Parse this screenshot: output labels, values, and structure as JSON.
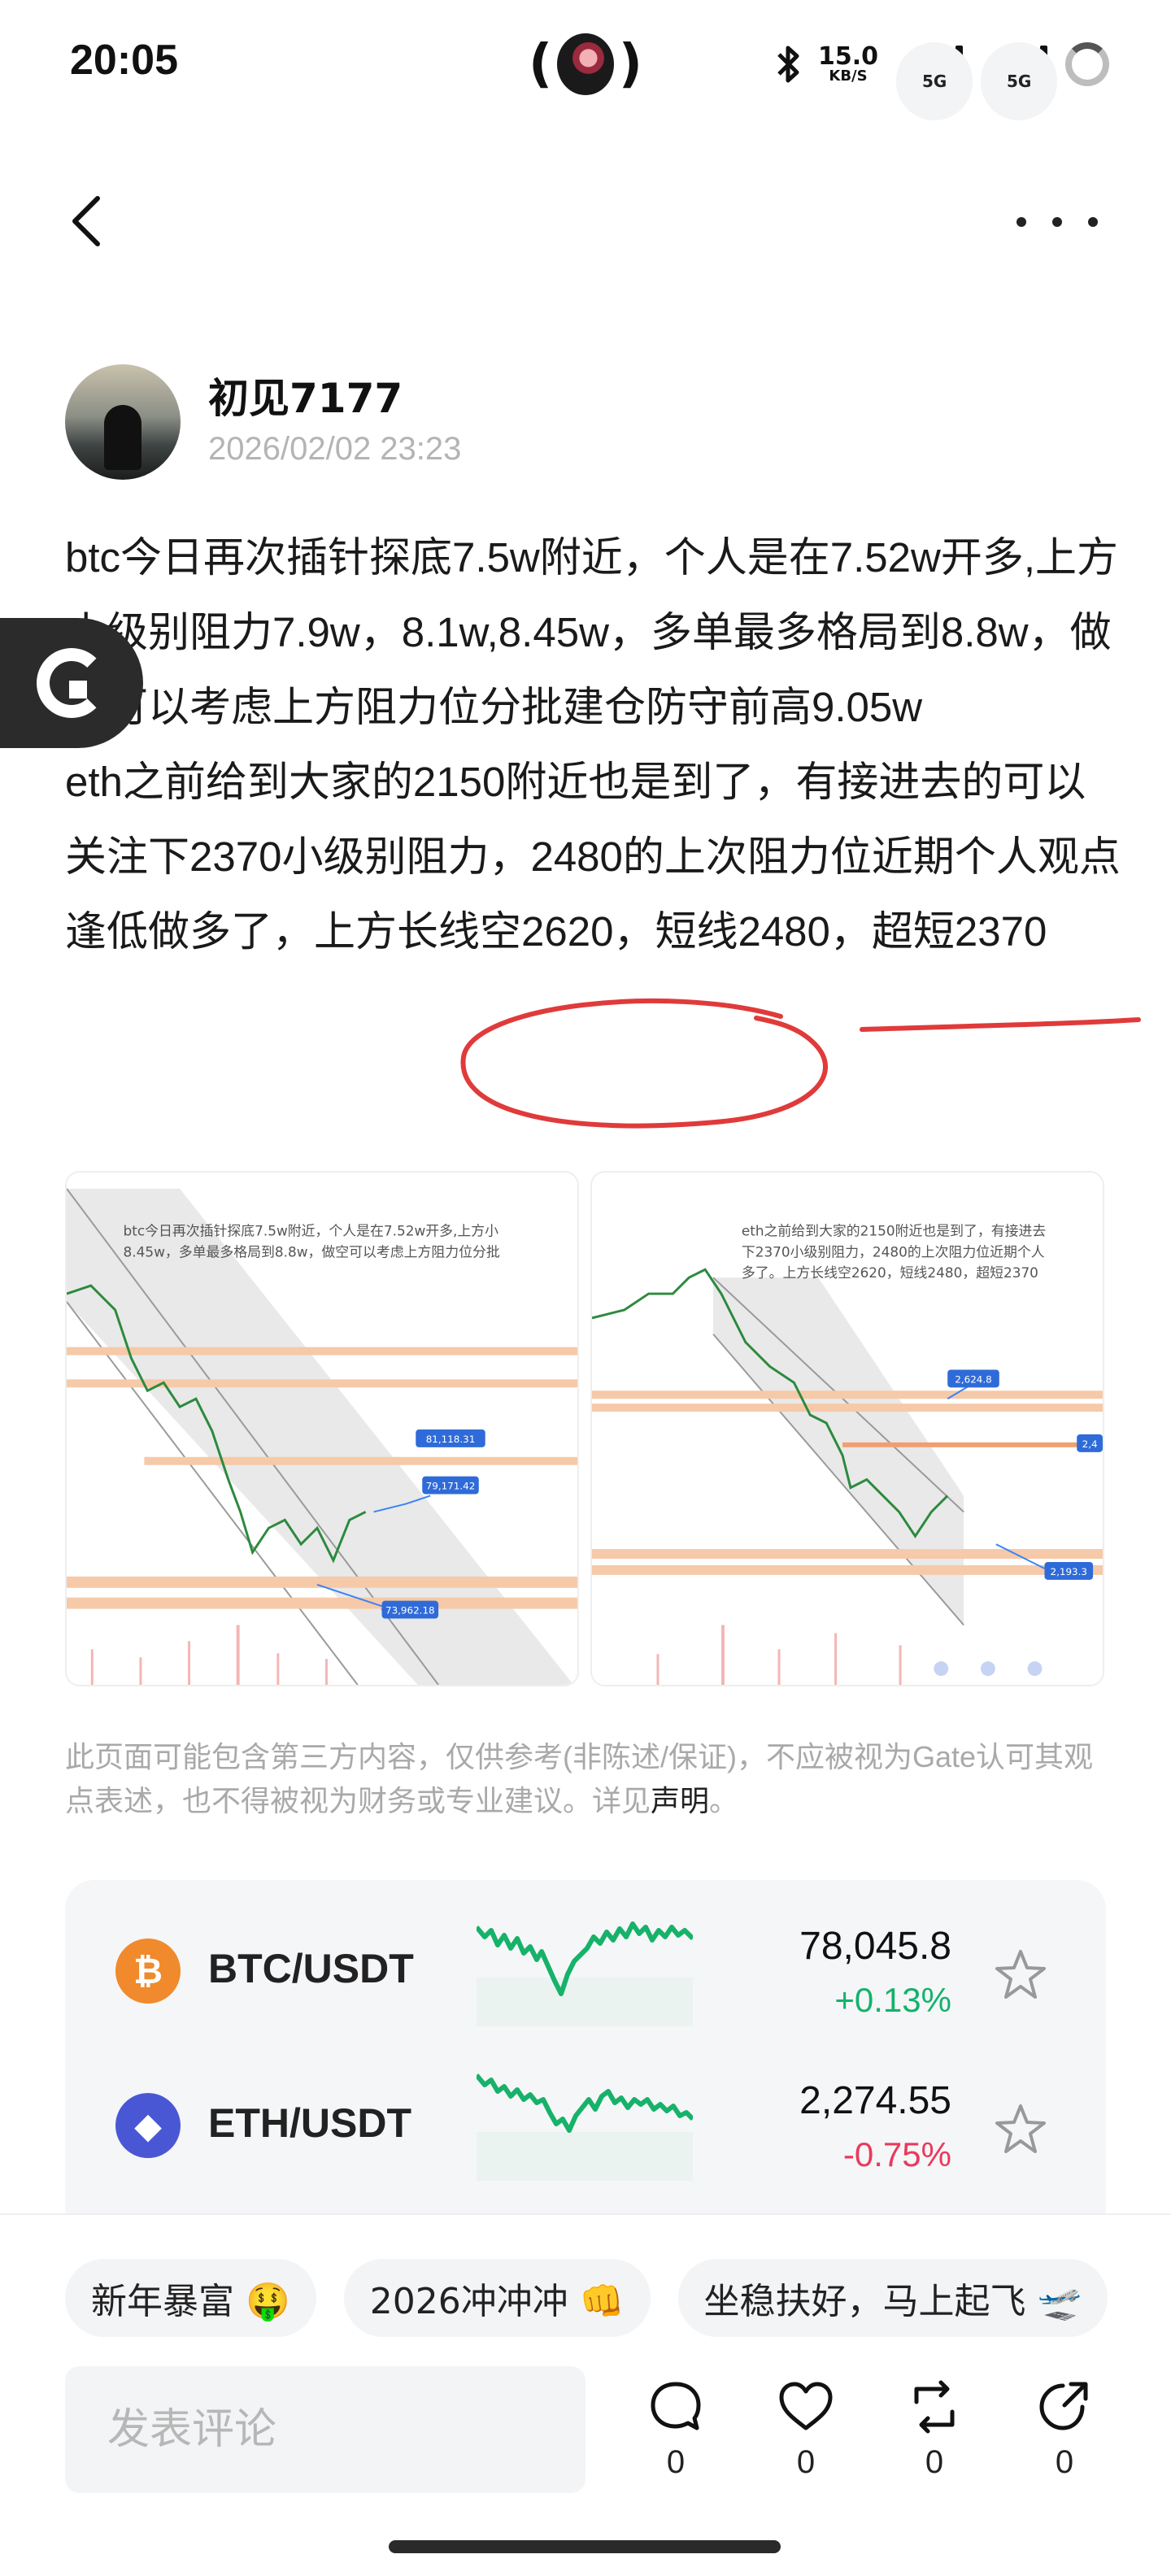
{
  "status_bar": {
    "time": "20:05",
    "center_left": "(",
    "center_right": ")",
    "speed_value": "15.0",
    "speed_unit": "KB/S",
    "sim1": "5G",
    "sim2": "5G",
    "icons": [
      "bluetooth-icon",
      "signal-icon",
      "signal-icon",
      "battery-ring-icon"
    ]
  },
  "nav": {
    "back_icon": "chevron-left-icon",
    "more_icon": "more-dots-icon"
  },
  "author": {
    "name": "初见7177",
    "time": "2026/02/02 23:23"
  },
  "post": {
    "paragraph1": "btc今日再次插针探底7.5w附近，个人是在7.52w开多,上方小级别阻力7.9w，8.1w,8.45w，多单最多格局到8.8w，做空可以考虑上方阻力位分批建仓防守前高9.05w",
    "paragraph2": "eth之前给到大家的2150附近也是到了，有接进去的可以关注下2370小级别阻力，2480的上次阻力位近期个人观点逢低做多了，上方长线空2620，短线2480，超短2370"
  },
  "images": [
    {
      "overlay_text_line1": "btc今日再次插针探底7.5w附近，个人是在7.52w开多,上方小",
      "overlay_text_line2": "8.45w，多单最多格局到8.8w，做空可以考虑上方阻力位分批",
      "labels": [
        "81,118.31",
        "79,171.42",
        "73,962.18"
      ]
    },
    {
      "overlay_text_line1": "eth之前给到大家的2150附近也是到了，有接进去",
      "overlay_text_line2": "下2370小级别阻力，2480的上次阻力位近期个人",
      "overlay_text_line3": "多了。上方长线空2620，短线2480，超短2370",
      "labels": [
        "2,624.8",
        "2,4",
        "2,193.3"
      ]
    }
  ],
  "disclaimer": {
    "text": "此页面可能包含第三方内容，仅供参考(非陈述/保证)，不应被视为Gate认可其观点表述，也不得被视为财务或专业建议。详见",
    "link": "声明",
    "end": "。"
  },
  "market": [
    {
      "symbol": "BTC/USDT",
      "price": "78,045.8",
      "change": "+0.13%",
      "coin_glyph": "₿",
      "coin_color": "#f08a2c",
      "change_color": "#13b26b",
      "spark_color": "#17b26a"
    },
    {
      "symbol": "ETH/USDT",
      "price": "2,274.55",
      "change": "-0.75%",
      "coin_glyph": "◆",
      "coin_color": "#4a57d4",
      "change_color": "#ea3a5c",
      "spark_color": "#17b26a"
    }
  ],
  "tags": [
    "新年暴富 🤑",
    "2026冲冲冲 👊",
    "坐稳扶好，马上起飞 🛫"
  ],
  "comment": {
    "placeholder": "发表评论"
  },
  "actions": [
    {
      "name": "comment",
      "icon": "comment-bubble-icon",
      "count": "0"
    },
    {
      "name": "like",
      "icon": "heart-icon",
      "count": "0"
    },
    {
      "name": "repost",
      "icon": "repost-icon",
      "count": "0"
    },
    {
      "name": "share",
      "icon": "share-icon",
      "count": "0"
    }
  ]
}
